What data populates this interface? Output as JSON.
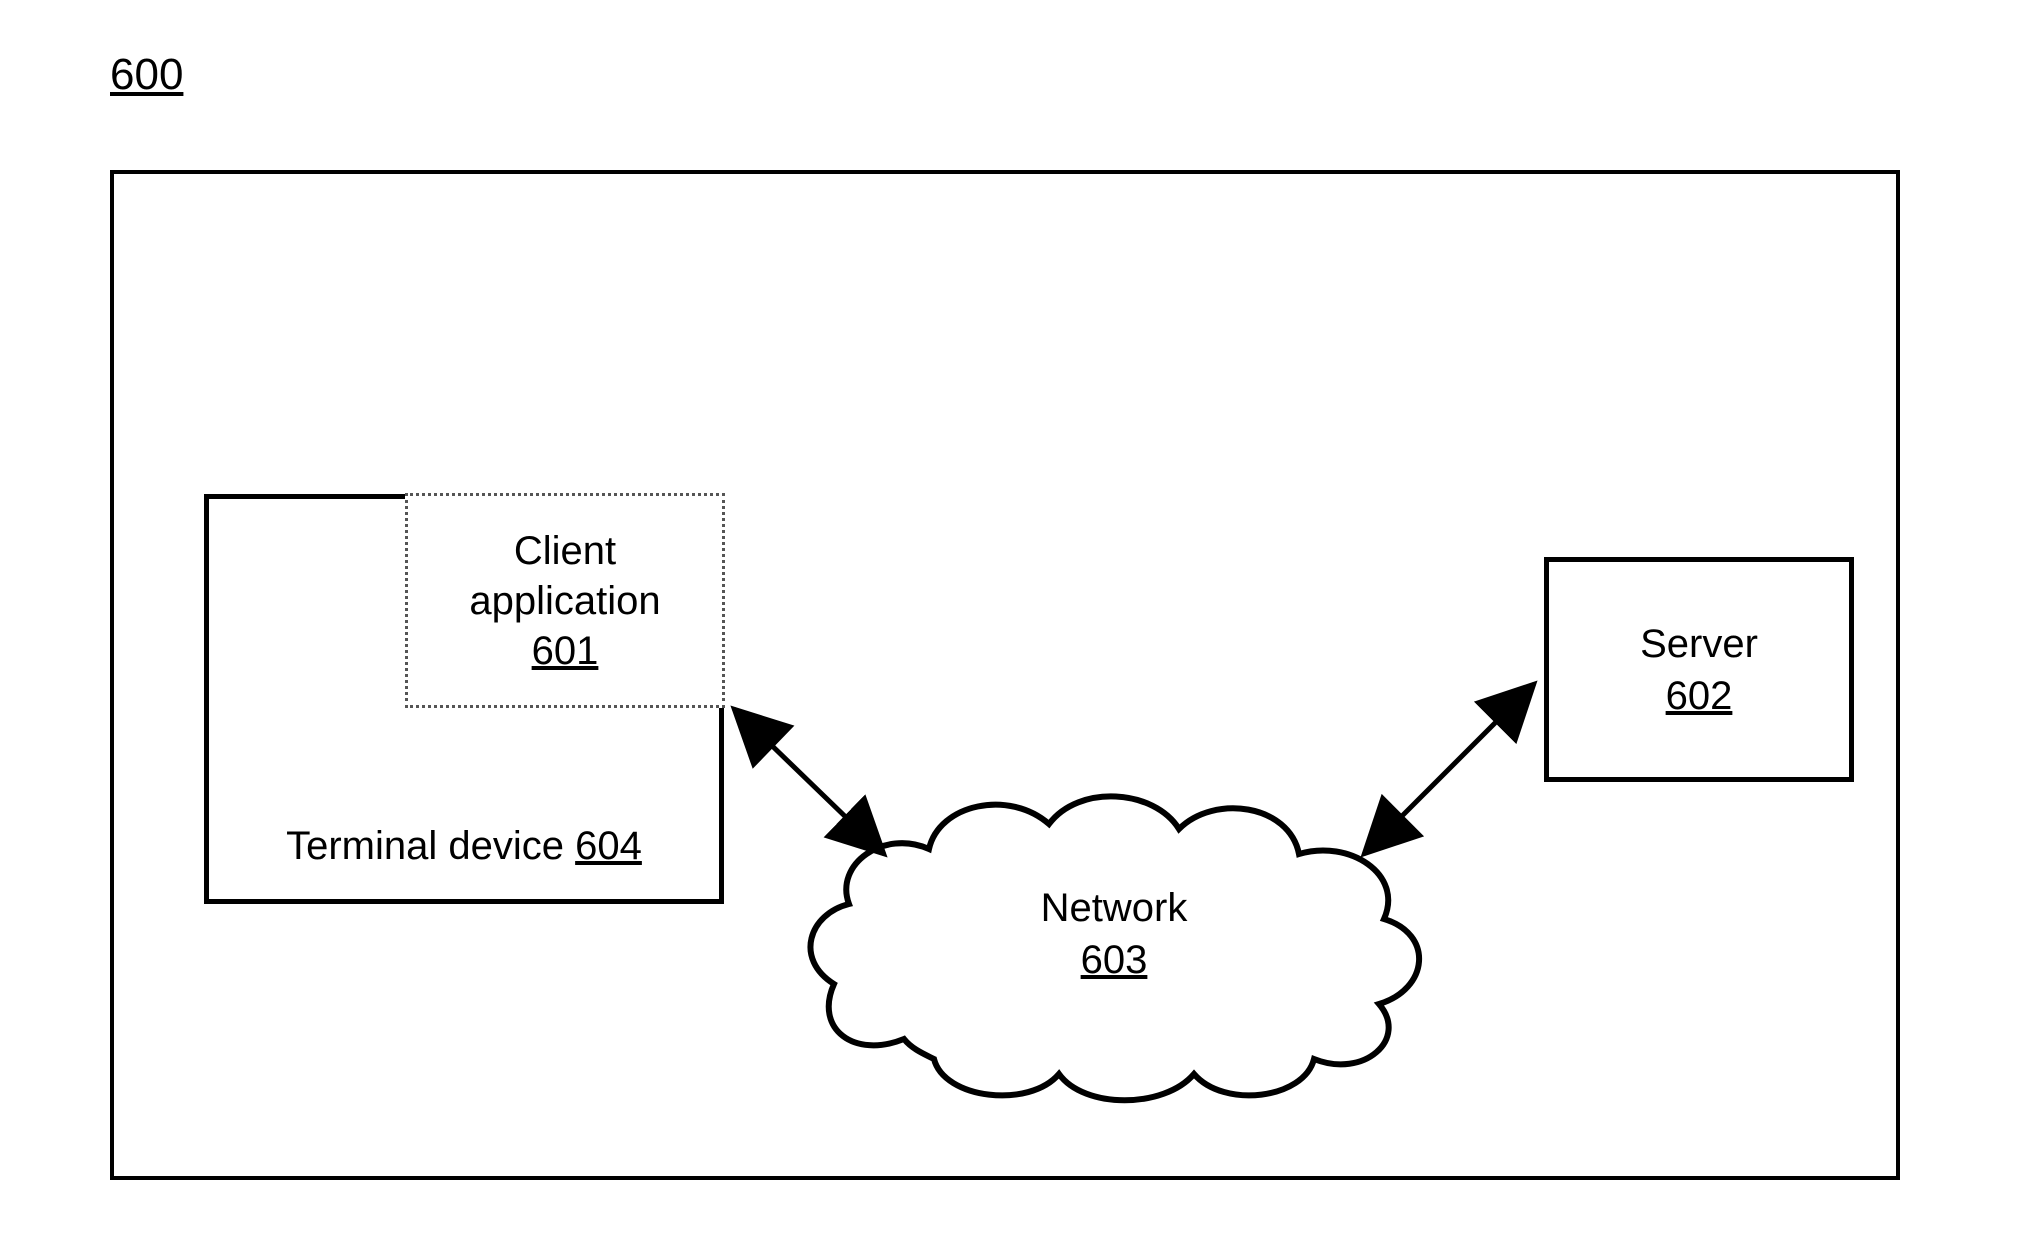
{
  "figure_number": "600",
  "client_app": {
    "line1": "Client",
    "line2": "application",
    "ref": "601"
  },
  "terminal_device": {
    "label": "Terminal device",
    "ref": "604"
  },
  "server": {
    "label": "Server",
    "ref": "602"
  },
  "network": {
    "label": "Network",
    "ref": "603"
  }
}
